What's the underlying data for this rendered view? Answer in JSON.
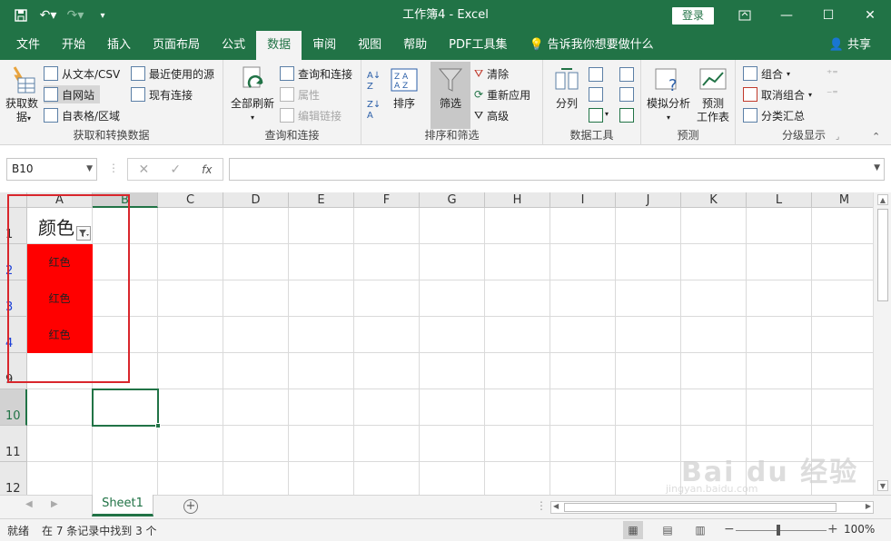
{
  "window": {
    "title": "工作簿4  -  Excel",
    "login_label": "登录"
  },
  "tabs": [
    {
      "label": "文件"
    },
    {
      "label": "开始"
    },
    {
      "label": "插入"
    },
    {
      "label": "页面布局"
    },
    {
      "label": "公式"
    },
    {
      "label": "数据",
      "active": true
    },
    {
      "label": "审阅"
    },
    {
      "label": "视图"
    },
    {
      "label": "帮助"
    },
    {
      "label": "PDF工具集"
    }
  ],
  "tell_me": "告诉我你想要做什么",
  "share_label": "共享",
  "ribbon": {
    "get_transform": {
      "label": "获取和转换数据",
      "get_data": "获取数\n据",
      "from_text": "从文本/CSV",
      "from_web": "自网站",
      "from_table": "自表格/区域",
      "recent_sources": "最近使用的源",
      "existing_conn": "现有连接"
    },
    "queries": {
      "label": "查询和连接",
      "refresh_all": "全部刷新",
      "queries_conn": "查询和连接",
      "properties": "属性",
      "edit_links": "编辑链接"
    },
    "sort_filter": {
      "label": "排序和筛选",
      "sort": "排序",
      "filter": "筛选",
      "clear": "清除",
      "reapply": "重新应用",
      "advanced": "高级"
    },
    "data_tools": {
      "label": "数据工具",
      "text_to_columns": "分列"
    },
    "forecast": {
      "label": "预测",
      "what_if": "模拟分析",
      "forecast_sheet": "预测\n工作表"
    },
    "outline": {
      "label": "分级显示",
      "group": "组合",
      "ungroup": "取消组合",
      "subtotal": "分类汇总"
    }
  },
  "formula_bar": {
    "name_box": "B10",
    "fx": "fx",
    "cancel": "✕",
    "enter": "✓",
    "value": ""
  },
  "grid": {
    "columns": [
      "A",
      "B",
      "C",
      "D",
      "E",
      "F",
      "G",
      "H",
      "I",
      "J",
      "K",
      "L",
      "M"
    ],
    "rows": [
      {
        "num": "1",
        "a": "颜色",
        "red": false,
        "filtered": false
      },
      {
        "num": "2",
        "a": "红色",
        "red": true,
        "filtered": true
      },
      {
        "num": "3",
        "a": "红色",
        "red": true,
        "filtered": true
      },
      {
        "num": "4",
        "a": "红色",
        "red": true,
        "filtered": true
      },
      {
        "num": "9",
        "a": "",
        "red": false,
        "filtered": false
      },
      {
        "num": "10",
        "a": "",
        "red": false,
        "filtered": false
      },
      {
        "num": "11",
        "a": "",
        "red": false,
        "filtered": false
      },
      {
        "num": "12",
        "a": "",
        "red": false,
        "filtered": false
      }
    ]
  },
  "sheet_tab": "Sheet1",
  "status": {
    "ready": "就绪",
    "filter_msg": "在 7 条记录中找到 3 个",
    "zoom": "100%"
  },
  "colors": {
    "excel_green": "#217346",
    "highlight_red": "#ff0000",
    "annotation_red": "#d9262c"
  },
  "watermark": {
    "brand": "Bai du 经验",
    "url": "jingyan.baidu.com"
  }
}
